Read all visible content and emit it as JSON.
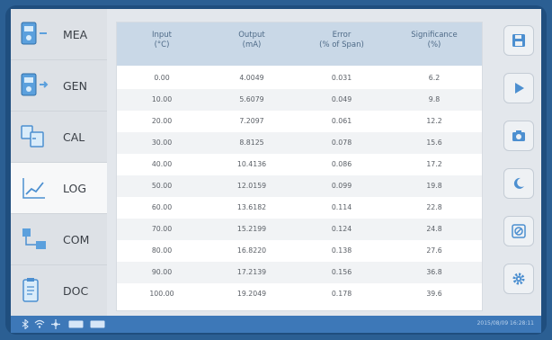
{
  "sidebar": {
    "items": [
      {
        "label": "MEA",
        "icon": "meter-icon"
      },
      {
        "label": "GEN",
        "icon": "generator-icon"
      },
      {
        "label": "CAL",
        "icon": "calibrate-icon"
      },
      {
        "label": "LOG",
        "icon": "chart-line-icon"
      },
      {
        "label": "COM",
        "icon": "network-icon"
      },
      {
        "label": "DOC",
        "icon": "clipboard-icon"
      }
    ],
    "active": "LOG"
  },
  "table": {
    "headers": [
      {
        "line1": "Input",
        "line2": "(°C)"
      },
      {
        "line1": "Output",
        "line2": "(mA)"
      },
      {
        "line1": "Error",
        "line2": "(% of Span)"
      },
      {
        "line1": "Significance",
        "line2": "(%)"
      }
    ],
    "rows": [
      [
        "0.00",
        "4.0049",
        "0.031",
        "6.2"
      ],
      [
        "10.00",
        "5.6079",
        "0.049",
        "9.8"
      ],
      [
        "20.00",
        "7.2097",
        "0.061",
        "12.2"
      ],
      [
        "30.00",
        "8.8125",
        "0.078",
        "15.6"
      ],
      [
        "40.00",
        "10.4136",
        "0.086",
        "17.2"
      ],
      [
        "50.00",
        "12.0159",
        "0.099",
        "19.8"
      ],
      [
        "60.00",
        "13.6182",
        "0.114",
        "22.8"
      ],
      [
        "70.00",
        "15.2199",
        "0.124",
        "24.8"
      ],
      [
        "80.00",
        "16.8220",
        "0.138",
        "27.6"
      ],
      [
        "90.00",
        "17.2139",
        "0.156",
        "36.8"
      ],
      [
        "100.00",
        "19.2049",
        "0.178",
        "39.6"
      ]
    ]
  },
  "right_toolbar": {
    "buttons": [
      "save-icon",
      "play-icon",
      "camera-icon",
      "night-mode-icon",
      "disable-icon",
      "settings-icon"
    ]
  },
  "status_bar": {
    "icons": [
      "bluetooth-icon",
      "wifi-icon",
      "usb-icon",
      "battery-icon",
      "battery-icon"
    ],
    "datetime": "2015/08/09 16:28:11"
  },
  "colors": {
    "frame": "#1f4e7e",
    "header": "#c9d8e7",
    "status_bar": "#3d78b8",
    "toolbar_icon": "#4c8fd0"
  }
}
